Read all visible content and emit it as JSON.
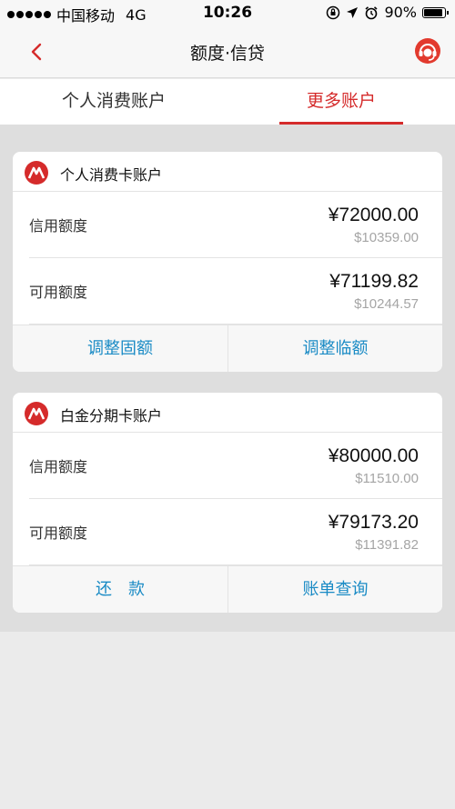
{
  "status_bar": {
    "carrier": "中国移动",
    "network": "4G",
    "time": "10:26",
    "battery": "90%",
    "battery_level": 0.9
  },
  "nav": {
    "title": "额度·信贷"
  },
  "tabs": [
    {
      "label": "个人消费账户",
      "active": false
    },
    {
      "label": "更多账户",
      "active": true
    }
  ],
  "accounts": [
    {
      "title": "个人消费卡账户",
      "rows": [
        {
          "label": "信用额度",
          "amount": "¥72000.00",
          "usd": "$10359.00"
        },
        {
          "label": "可用额度",
          "amount": "¥71199.82",
          "usd": "$10244.57"
        }
      ],
      "actions": [
        "调整固额",
        "调整临额"
      ]
    },
    {
      "title": "白金分期卡账户",
      "rows": [
        {
          "label": "信用额度",
          "amount": "¥80000.00",
          "usd": "$11510.00"
        },
        {
          "label": "可用额度",
          "amount": "¥79173.20",
          "usd": "$11391.82"
        }
      ],
      "actions": [
        "还　款",
        "账单查询"
      ]
    }
  ],
  "colors": {
    "accent_red": "#d52b2b",
    "action_blue": "#1a8bc5"
  }
}
